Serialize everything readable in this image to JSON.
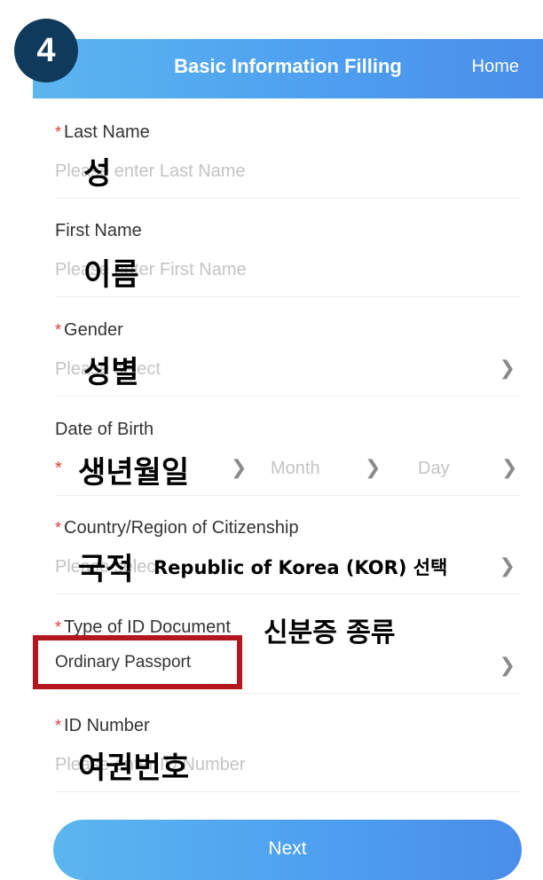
{
  "header": {
    "title": "Basic Information Filling",
    "home": "Home",
    "step": "4"
  },
  "fields": {
    "last_name": {
      "required": "*",
      "label": "Last Name",
      "placeholder": "Please enter Last Name",
      "annotation": "성"
    },
    "first_name": {
      "label": "First Name",
      "placeholder": "Please enter First Name",
      "annotation": "이름"
    },
    "gender": {
      "required": "*",
      "label": "Gender",
      "placeholder": "Please select",
      "annotation": "성별"
    },
    "dob": {
      "label": "Date of Birth",
      "required": "*",
      "month": "Month",
      "day": "Day",
      "annotation": "생년월일"
    },
    "citizenship": {
      "required": "*",
      "label": "Country/Region of Citizenship",
      "placeholder": "Please select",
      "annotation": "국적",
      "annotation_hint": "Republic of Korea (KOR) 선택"
    },
    "id_type": {
      "required": "*",
      "label": "Type of ID Document",
      "value": "Ordinary Passport",
      "annotation": "신분증 종류"
    },
    "id_number": {
      "required": "*",
      "label": "ID Number",
      "placeholder": "Please enter ID Number",
      "annotation": "여권번호"
    }
  },
  "next_button": "Next",
  "icons": {
    "chevron": "chevron-right-icon"
  },
  "colors": {
    "accent": "#4d9ef0",
    "required": "#e4393c",
    "highlight": "#b3161d",
    "badge": "#0f3a5c"
  }
}
